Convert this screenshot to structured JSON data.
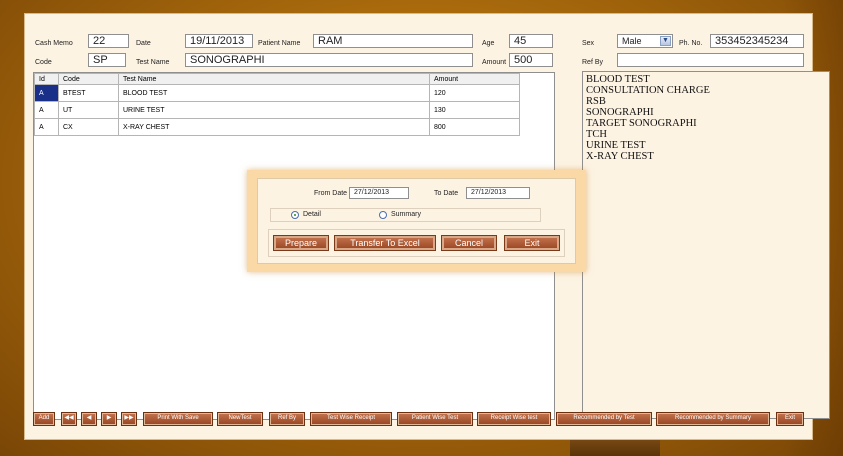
{
  "header": {
    "cash_memo_label": "Cash Memo",
    "cash_memo_value": "22",
    "date_label": "Date",
    "date_value": "19/11/2013",
    "patient_name_label": "Patient Name",
    "patient_name_value": "RAM",
    "age_label": "Age",
    "age_value": "45",
    "sex_label": "Sex",
    "sex_value": "Male",
    "phone_label": "Ph. No.",
    "phone_value": "353452345234",
    "code_label": "Code",
    "code_value": "SP",
    "test_name_label": "Test Name",
    "test_name_value": "SONOGRAPHI",
    "amount_label": "Amount",
    "amount_value": "500",
    "ref_by_label": "Ref By",
    "ref_by_value": ""
  },
  "grid": {
    "columns": [
      "Id",
      "Code",
      "Test Name",
      "Amount"
    ],
    "rows": [
      {
        "id": "A",
        "code": "BTEST",
        "test_name": "BLOOD TEST",
        "amount": "120"
      },
      {
        "id": "A",
        "code": "UT",
        "test_name": "URINE TEST",
        "amount": "130"
      },
      {
        "id": "A",
        "code": "CX",
        "test_name": "X-RAY CHEST",
        "amount": "800"
      }
    ]
  },
  "test_list": [
    "BLOOD TEST",
    "CONSULTATION CHARGE",
    "RSB",
    "SONOGRAPHI",
    "TARGET SONOGRAPHI",
    "TCH",
    "URINE TEST",
    "X-RAY CHEST"
  ],
  "dialog": {
    "from_date_label": "From Date",
    "from_date_value": "27/12/2013",
    "to_date_label": "To Date",
    "to_date_value": "27/12/2013",
    "detail_label": "Detail",
    "summary_label": "Summary",
    "prepare_label": "Prepare",
    "excel_label": "Transfer To Excel",
    "cancel_label": "Cancel",
    "exit_label": "Exit"
  },
  "toolbar": {
    "add": "Add",
    "first": "◀◀",
    "prev": "◀",
    "next": "▶",
    "last": "▶▶",
    "print_with_save": "Print With Save",
    "new_test": "NewTest",
    "ref_by": "Ref By",
    "test_wise_receipt": "Test Wise Receipt",
    "patient_wise_test": "Patient Wise Test",
    "receipt_wise_test": "Receipt Wise test",
    "recommended_by_test": "Recommended by Test",
    "recommended_by_summary": "Recommended by Summary",
    "exit": "Exit"
  }
}
